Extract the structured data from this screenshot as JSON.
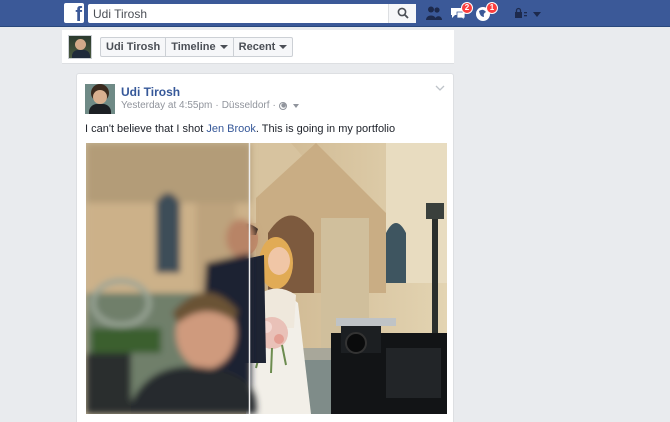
{
  "topbar": {
    "logo_letter": "f",
    "search_value": "Udi Tirosh",
    "icons": [
      "facebook-logo-icon",
      "search-icon",
      "friend-requests-icon",
      "messages-icon",
      "notifications-icon",
      "privacy-shortcuts-icon",
      "account-menu-icon"
    ],
    "messages_count": "2",
    "notifications_count": "1",
    "brand_color": "#3b5998"
  },
  "strip": {
    "name": "Udi Tirosh",
    "timeline_label": "Timeline",
    "recent_label": "Recent"
  },
  "post": {
    "author": "Udi Tirosh",
    "time": "Yesterday at 4:55pm",
    "separator": "·",
    "location": "Düsseldorf",
    "separator2": "·",
    "text_before": "I can't believe that I shot ",
    "tag": "Jen Brook",
    "text_after": ". This is going in my portfolio",
    "link_color": "#365899"
  }
}
